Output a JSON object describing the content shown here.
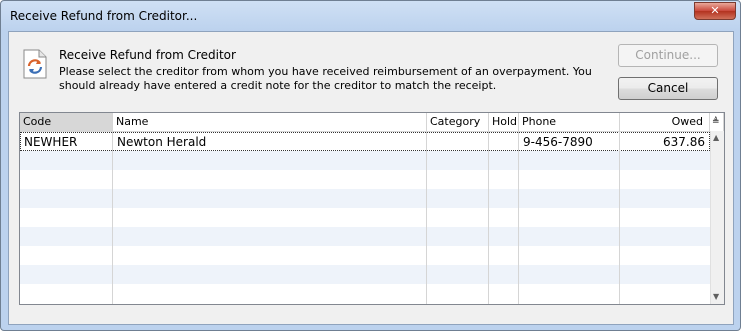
{
  "window": {
    "title": "Receive Refund from Creditor...",
    "close_glyph": "✕"
  },
  "header": {
    "icon": "refresh-document-icon",
    "title": "Receive Refund from Creditor",
    "description": "Please select the creditor from whom you have received reimbursement of an overpayment. You should already have entered a credit note for the creditor to match the receipt."
  },
  "buttons": {
    "continue_label": "Continue...",
    "cancel_label": "Cancel"
  },
  "table": {
    "columns": [
      "Code",
      "Name",
      "Category",
      "Hold",
      "Phone",
      "Owed"
    ],
    "rows": [
      {
        "code": "NEWHER",
        "name": "Newton Herald",
        "category": "",
        "hold": "",
        "phone": "9-456-7890",
        "owed": "637.86"
      }
    ]
  }
}
